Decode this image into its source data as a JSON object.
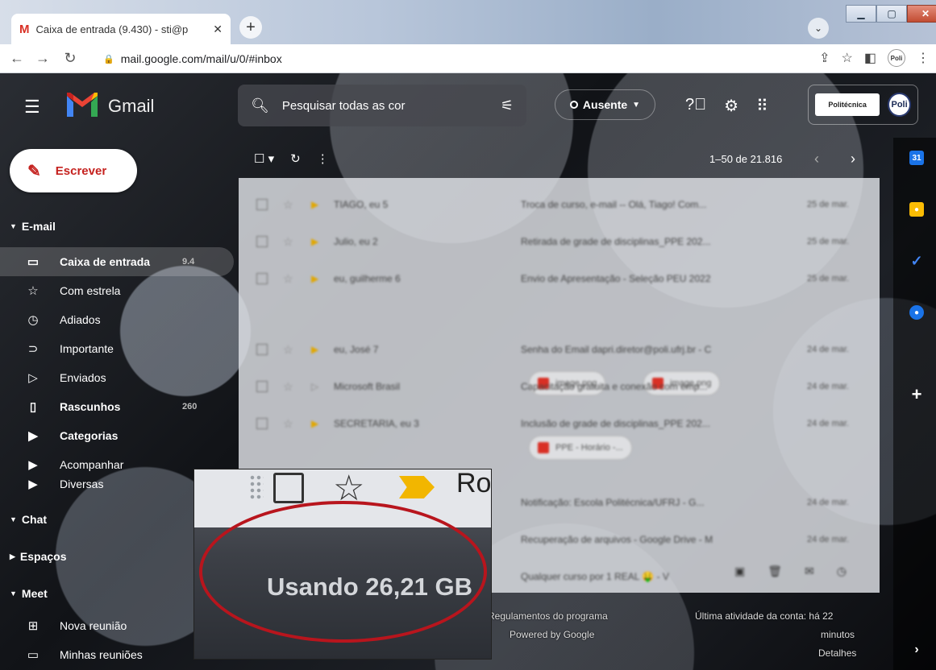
{
  "browser": {
    "tab_title": "Caixa de entrada (9.430) - sti@p",
    "tab_favicon": "M",
    "new_tab": "+",
    "url": "mail.google.com/mail/u/0/#inbox",
    "profile_label": "Poli"
  },
  "gmail": {
    "product_name": "Gmail",
    "search_placeholder": "Pesquisar todas as cor",
    "status": "Ausente",
    "account_org": "Politécnica",
    "account_avatar": "Poli",
    "compose_label": "Escrever"
  },
  "sidebar": {
    "email_section": "E-mail",
    "items": [
      {
        "label": "Caixa de entrada",
        "count": "9.4",
        "icon": "inbox-icon",
        "active": true
      },
      {
        "label": "Com estrela",
        "icon": "star-icon"
      },
      {
        "label": "Adiados",
        "icon": "clock-icon"
      },
      {
        "label": "Importante",
        "icon": "important-icon"
      },
      {
        "label": "Enviados",
        "icon": "send-icon"
      },
      {
        "label": "Rascunhos",
        "count": "260",
        "icon": "draft-icon"
      },
      {
        "label": "Categorias",
        "icon": "label-icon"
      },
      {
        "label": "Acompanhar",
        "icon": "label-icon"
      },
      {
        "label": "Diversas",
        "icon": "label-icon"
      }
    ],
    "chat_section": "Chat",
    "spaces_section": "Espaços",
    "meet_section": "Meet",
    "meet_items": [
      {
        "label": "Nova reunião",
        "icon": "video-add-icon"
      },
      {
        "label": "Minhas reuniões",
        "icon": "calendar-icon"
      }
    ]
  },
  "toolbar": {
    "pagination": "1–50 de 21.816"
  },
  "emails": [
    {
      "from": "TIAGO, eu 5",
      "subject": "Troca de curso, e-mail -- Olá, Tiago! Com...",
      "date": "25 de mar."
    },
    {
      "from": "Julio, eu 2",
      "subject": "Retirada de grade de disciplinas_PPE 202...",
      "date": "25 de mar."
    },
    {
      "from": "eu, guilherme 6",
      "subject": "Envio de Apresentação - Seleção PEU 2022",
      "date": "25 de mar."
    },
    {
      "from": "eu, José 7",
      "subject": "Senha do Email dapri.diretor@poli.ufrj.br - C",
      "date": "24 de mar."
    },
    {
      "from": "Microsoft Brasil",
      "subject": "Capacitação gratuita e conexão com emp...",
      "date": "24 de mar."
    },
    {
      "from": "SECRETARIA, eu 3",
      "subject": "Inclusão de grade de disciplinas_PPE 202...",
      "date": "24 de mar."
    },
    {
      "from": "",
      "subject": "Notificação: Escola Politécnica/UFRJ - G...",
      "date": "24 de mar."
    },
    {
      "from": "",
      "subject": "Recuperação de arquivos - Google Drive - M",
      "date": "24 de mar."
    },
    {
      "from": "",
      "subject": "Qualquer curso por 1 REAL 🤑 - V",
      "date": ""
    }
  ],
  "attachments": {
    "a1": "image.png",
    "a2": "image.png",
    "a3": "PPE - Horário -..."
  },
  "footer": {
    "program": "Regulamentos do programa",
    "powered": "Powered by Google",
    "activity": "Última atividade da conta: há 22",
    "minutes": "minutos",
    "details": "Detalhes"
  },
  "zoom": {
    "from_fragment": "Ro",
    "usage": "Usando 26,21 GB"
  },
  "colors": {
    "gmail_red": "#c5221f",
    "highlight_circle": "#b8151d",
    "important_marker": "#f2b600"
  }
}
